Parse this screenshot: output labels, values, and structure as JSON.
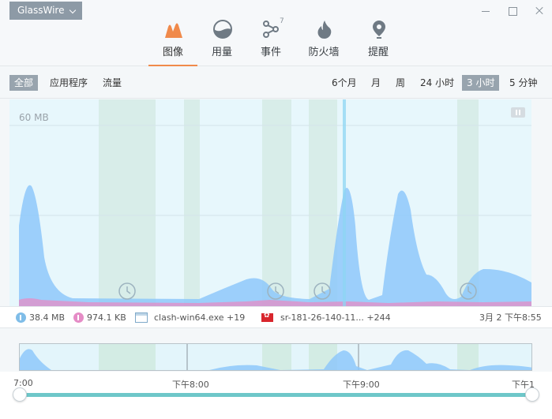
{
  "app": {
    "title": "GlassWire"
  },
  "nav": {
    "items": [
      {
        "label": "图像",
        "icon": "graph-icon",
        "active": true
      },
      {
        "label": "用量",
        "icon": "usage-icon",
        "active": false
      },
      {
        "label": "事件",
        "icon": "events-icon",
        "badge": "7",
        "active": false
      },
      {
        "label": "防火墙",
        "icon": "firewall-icon",
        "active": false
      },
      {
        "label": "提醒",
        "icon": "alerts-icon",
        "active": false
      }
    ]
  },
  "toolbar": {
    "filters": [
      "全部",
      "应用程序",
      "流量"
    ],
    "selected_filter": "全部",
    "ranges": [
      "6个月",
      "月",
      "周",
      "24 小时",
      "3 小时",
      "5 分钟"
    ],
    "selected_range": "3 小时"
  },
  "chart": {
    "ylabel": "60 MB"
  },
  "stats": {
    "download": "38.4 MB",
    "upload": "974.1 KB",
    "app": "clash-win64.exe +19",
    "host": "sr-181-26-140-11... +244",
    "time": "3月 2 下午8:55"
  },
  "timeline": {
    "ticks": [
      "7:00",
      "下午8:00",
      "下午9:00",
      "下午1"
    ]
  },
  "colors": {
    "download": "#8ec8fa",
    "upload": "#e58cc6",
    "accent": "#f08a4b",
    "range": "#6ec7c9"
  }
}
